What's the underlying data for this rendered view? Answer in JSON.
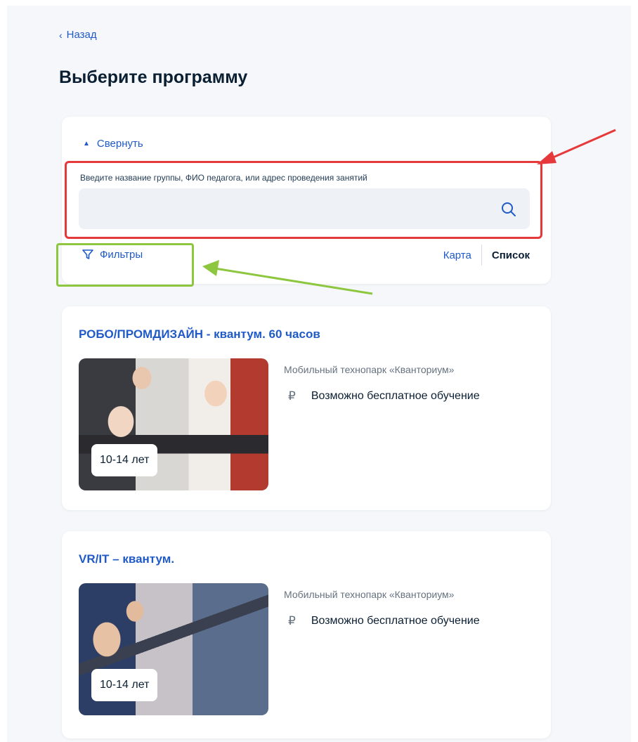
{
  "header": {
    "back_label": "Назад",
    "title": "Выберите программу"
  },
  "search": {
    "collapse_label": "Свернуть",
    "field_label": "Введите название группы, ФИО педагога, или адрес проведения занятий",
    "value": "",
    "filters_label": "Фильтры",
    "view_map_label": "Карта",
    "view_list_label": "Список",
    "active_view": "Список"
  },
  "programs": [
    {
      "title": "РОБО/ПРОМДИЗАЙН - квантум. 60 часов",
      "age": "10-14 лет",
      "provider": "Мобильный технопарк «Кванториум»",
      "feature": "Возможно бесплатное обучение"
    },
    {
      "title": "VR/IT – квантум.",
      "age": "10-14 лет",
      "provider": "Мобильный технопарк «Кванториум»",
      "feature": "Возможно бесплатное обучение"
    }
  ],
  "icons": {
    "back": "chevron-left-icon",
    "collapse": "chevron-up-icon",
    "search": "search-icon",
    "filters": "filter-icon",
    "payment": "ruble-icon"
  },
  "colors": {
    "link": "#1f5ac7",
    "text": "#0b1f33",
    "annotation_red": "#e6393c",
    "annotation_green": "#8dc63f"
  }
}
